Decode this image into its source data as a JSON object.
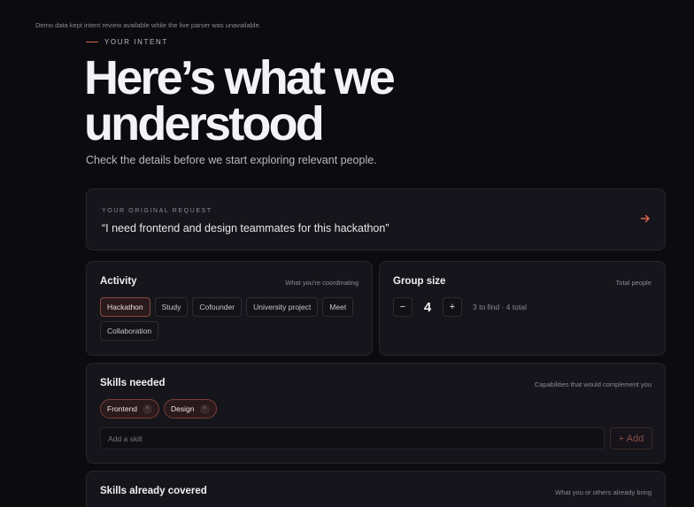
{
  "notice": "Demo data kept intent review available while the live parser was unavailable.",
  "eyebrow": "YOUR INTENT",
  "hero": {
    "line1": "Here’s what we",
    "line2": "understood"
  },
  "subtitle": "Check the details before we start exploring relevant people.",
  "request": {
    "label": "YOUR ORIGINAL REQUEST",
    "quote": "“I need frontend and design teammates for this hackathon”",
    "action_icon": "arrow-right-icon"
  },
  "activity": {
    "title": "Activity",
    "hint": "What you're coordinating",
    "options": [
      "Hackathon",
      "Study",
      "Cofounder",
      "University project",
      "Meet",
      "Collaboration"
    ],
    "selected": "Hackathon"
  },
  "group_size": {
    "title": "Group size",
    "hint": "Total people",
    "minus_label": "−",
    "plus_label": "+",
    "value": "4",
    "info": "3 to find · 4 total"
  },
  "skills_needed": {
    "title": "Skills needed",
    "hint": "Capabilities that would complement you",
    "skills": [
      "Frontend",
      "Design"
    ],
    "remove_glyph": "×",
    "input_placeholder": "Add a skill",
    "add_label": "+ Add"
  },
  "skills_covered": {
    "title": "Skills already covered",
    "hint": "What you or others already bring"
  },
  "colors": {
    "background": "#0b0b10",
    "card": "#15151b",
    "accent": "#e06a4e"
  }
}
